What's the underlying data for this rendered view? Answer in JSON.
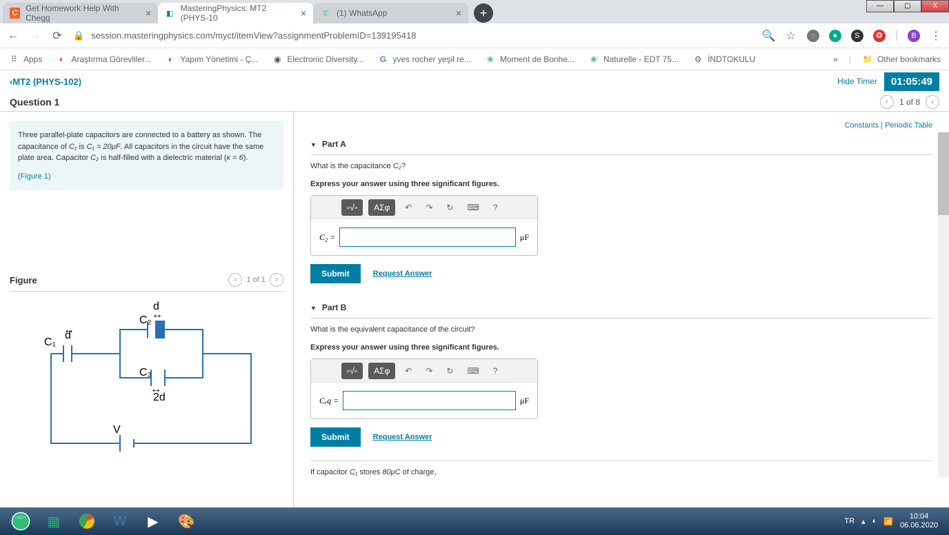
{
  "window": {
    "minimize": "—",
    "maximize": "▢",
    "close": "X"
  },
  "tabs": [
    {
      "icon": "C",
      "iconBg": "#f26522",
      "title": "Get Homework Help With Chegg",
      "active": false
    },
    {
      "icon": "◧",
      "iconBg": "#0b7fa3",
      "title": "MasteringPhysics: MT2 (PHYS-10",
      "active": true
    },
    {
      "icon": "①",
      "iconBg": "#25d366",
      "title": "(1) WhatsApp",
      "active": false
    }
  ],
  "newTab": "+",
  "nav": {
    "back": "←",
    "forward": "→",
    "reload": "⟳",
    "lock": "🔒"
  },
  "url": "session.masteringphysics.com/myct/itemView?assignmentProblemID=139195418",
  "addrIcons": {
    "search": "🔍",
    "star": "☆"
  },
  "extIcons": [
    {
      "bg": "#777",
      "char": "◌"
    },
    {
      "bg": "#0a8",
      "char": "●"
    },
    {
      "bg": "#333",
      "char": "S"
    },
    {
      "bg": "#d33",
      "char": "❂"
    },
    {
      "bg": "#8844cc",
      "char": "B"
    }
  ],
  "menuDots": "⋮",
  "bookmarks": {
    "apps": "Apps",
    "items": [
      {
        "icon": "◐",
        "color": "#d33",
        "label": "Araştırma Görevliler..."
      },
      {
        "icon": "◐",
        "color": "#d33",
        "label": "Yapım Yönetimi - Ç..."
      },
      {
        "icon": "◉",
        "color": "#555",
        "label": "Electronic Diversity..."
      },
      {
        "icon": "G",
        "color": "#4285f4",
        "label": "yves rocher yeşil re..."
      },
      {
        "icon": "❀",
        "color": "#5a8",
        "label": "Moment de Bonhe..."
      },
      {
        "icon": "❀",
        "color": "#5a8",
        "label": "Naturelle - EDT 75..."
      },
      {
        "icon": "⚙",
        "color": "#333",
        "label": "İNDTOKULU"
      }
    ],
    "more": "»",
    "other": "Other bookmarks"
  },
  "mp": {
    "back": "MT2 (PHYS-102)",
    "hideTimer": "Hide Timer",
    "timer": "01:05:49",
    "questionTitle": "Question 1",
    "pager": "1 of 8",
    "constants": "Constants",
    "periodic": "Periodic Table"
  },
  "problem": {
    "text1": "Three parallel-plate capacitors are connected to a battery as shown. The capacitance of ",
    "c1": "C₁",
    "is": " is ",
    "c1v": "C₁ = 20μF",
    "text2": ". All capacitors in the circuit have the same plate area. Capacitor ",
    "c2": "C₂",
    "text3": " is half-filled with a dielectric material (",
    "kappa": "κ = 6",
    "text4": ").",
    "figureLink": "(Figure 1)"
  },
  "figure": {
    "title": "Figure",
    "pager": "1 of 1",
    "labels": {
      "d1": "d",
      "d2": "d",
      "d3": "2d",
      "c1": "C₁",
      "c2": "C₂",
      "c3": "C₃",
      "v": "V"
    }
  },
  "toolbar": {
    "templates": "▫√▫",
    "symbols": "ΑΣφ",
    "undo": "↶",
    "redo": "↷",
    "reset": "↻",
    "kbd": "⌨",
    "help": "?"
  },
  "partA": {
    "title": "Part A",
    "question1": "What is the capacitance ",
    "question2": "C₂",
    "question3": "?",
    "instruction": "Express your answer using three significant figures.",
    "var": "C₂ =",
    "unit": "μF",
    "submit": "Submit",
    "request": "Request Answer"
  },
  "partB": {
    "title": "Part B",
    "question": "What is the equivalent capacitance of the circuit?",
    "instruction": "Express your answer using three significant figures.",
    "var": "Cₑq =",
    "unit": "μF",
    "submit": "Submit",
    "request": "Request Answer"
  },
  "bottomNote": {
    "t1": "If capacitor ",
    "c1": "C₁",
    "t2": " stores ",
    "q": "80μC",
    "t3": " of charge,"
  },
  "taskbar": {
    "lang": "TR",
    "time": "10:04",
    "date": "06.06.2020"
  }
}
